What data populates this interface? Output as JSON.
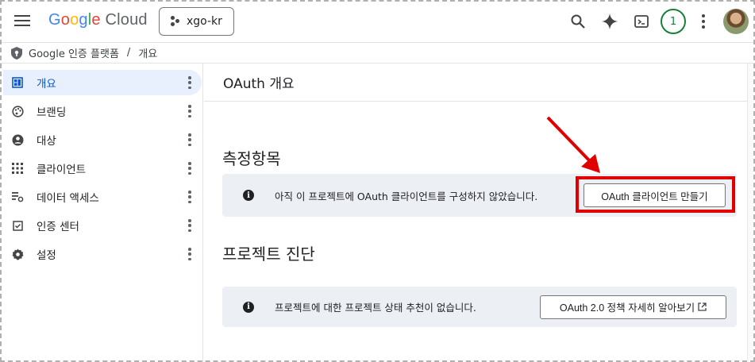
{
  "topbar": {
    "logo_letters": [
      "G",
      "o",
      "o",
      "g",
      "l",
      "e"
    ],
    "logo_suffix": "Cloud",
    "project_name": "xgo-kr",
    "notification_count": "1",
    "icons": [
      "menu-icon",
      "search-icon",
      "gemini-sparkle-icon",
      "cloud-shell-icon",
      "more-vert-icon",
      "user-avatar"
    ]
  },
  "breadcrumb": {
    "root": "Google 인증 플랫폼",
    "separator": "/",
    "current": "개요"
  },
  "sidebar": {
    "items": [
      {
        "label": "개요",
        "icon": "dashboard-icon",
        "active": true
      },
      {
        "label": "브랜딩",
        "icon": "palette-icon",
        "active": false
      },
      {
        "label": "대상",
        "icon": "account-circle-icon",
        "active": false
      },
      {
        "label": "클라이언트",
        "icon": "apps-grid-icon",
        "active": false
      },
      {
        "label": "데이터 액세스",
        "icon": "data-access-icon",
        "active": false
      },
      {
        "label": "인증 센터",
        "icon": "verified-checkbox-icon",
        "active": false
      },
      {
        "label": "설정",
        "icon": "gear-icon",
        "active": false
      }
    ]
  },
  "main": {
    "title": "OAuth 개요",
    "metrics": {
      "heading": "측정항목",
      "message": "아직 이 프로젝트에 OAuth 클라이언트를 구성하지 않았습니다.",
      "button_label": "OAuth 클라이언트 만들기"
    },
    "diagnostics": {
      "heading": "프로젝트 진단",
      "message": "프로젝트에 대한 프로젝트 상태 추천이 없습니다.",
      "button_label": "OAuth 2.0 정책 자세히 알아보기"
    }
  },
  "annotation": {
    "highlight_color": "#e00000"
  },
  "colors": {
    "accent": "#0b57d0",
    "active_nav_bg": "#e8f0fe",
    "info_box_bg": "#eceff3",
    "badge_green": "#188038"
  }
}
